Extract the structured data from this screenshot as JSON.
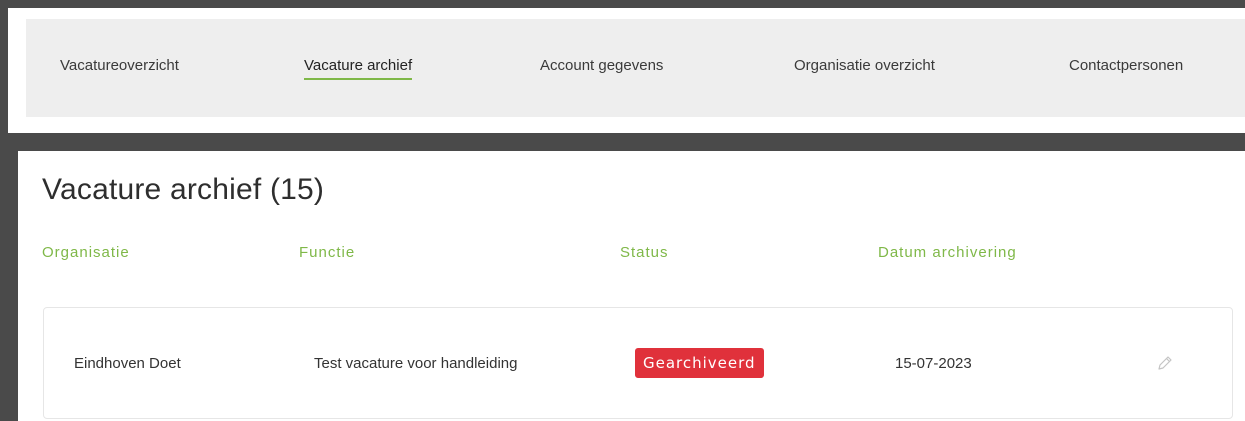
{
  "nav": {
    "items": [
      {
        "label": "Vacatureoverzicht",
        "active": false
      },
      {
        "label": "Vacature archief",
        "active": true
      },
      {
        "label": "Account gegevens",
        "active": false
      },
      {
        "label": "Organisatie overzicht",
        "active": false
      },
      {
        "label": "Contactpersonen",
        "active": false
      }
    ]
  },
  "page": {
    "title": "Vacature archief (15)"
  },
  "table": {
    "headers": [
      "Organisatie",
      "Functie",
      "Status",
      "Datum archivering"
    ],
    "rows": [
      {
        "organisatie": "Eindhoven Doet",
        "functie": "Test vacature voor handleiding",
        "status": "Gearchiveerd",
        "datum": "15-07-2023",
        "action_icon": "pencil-icon"
      }
    ]
  },
  "colors": {
    "accent_green": "#7fb848",
    "status_archived": "#e0313b",
    "nav_background": "#eeeeee",
    "outer_frame": "#4a4a4a"
  }
}
